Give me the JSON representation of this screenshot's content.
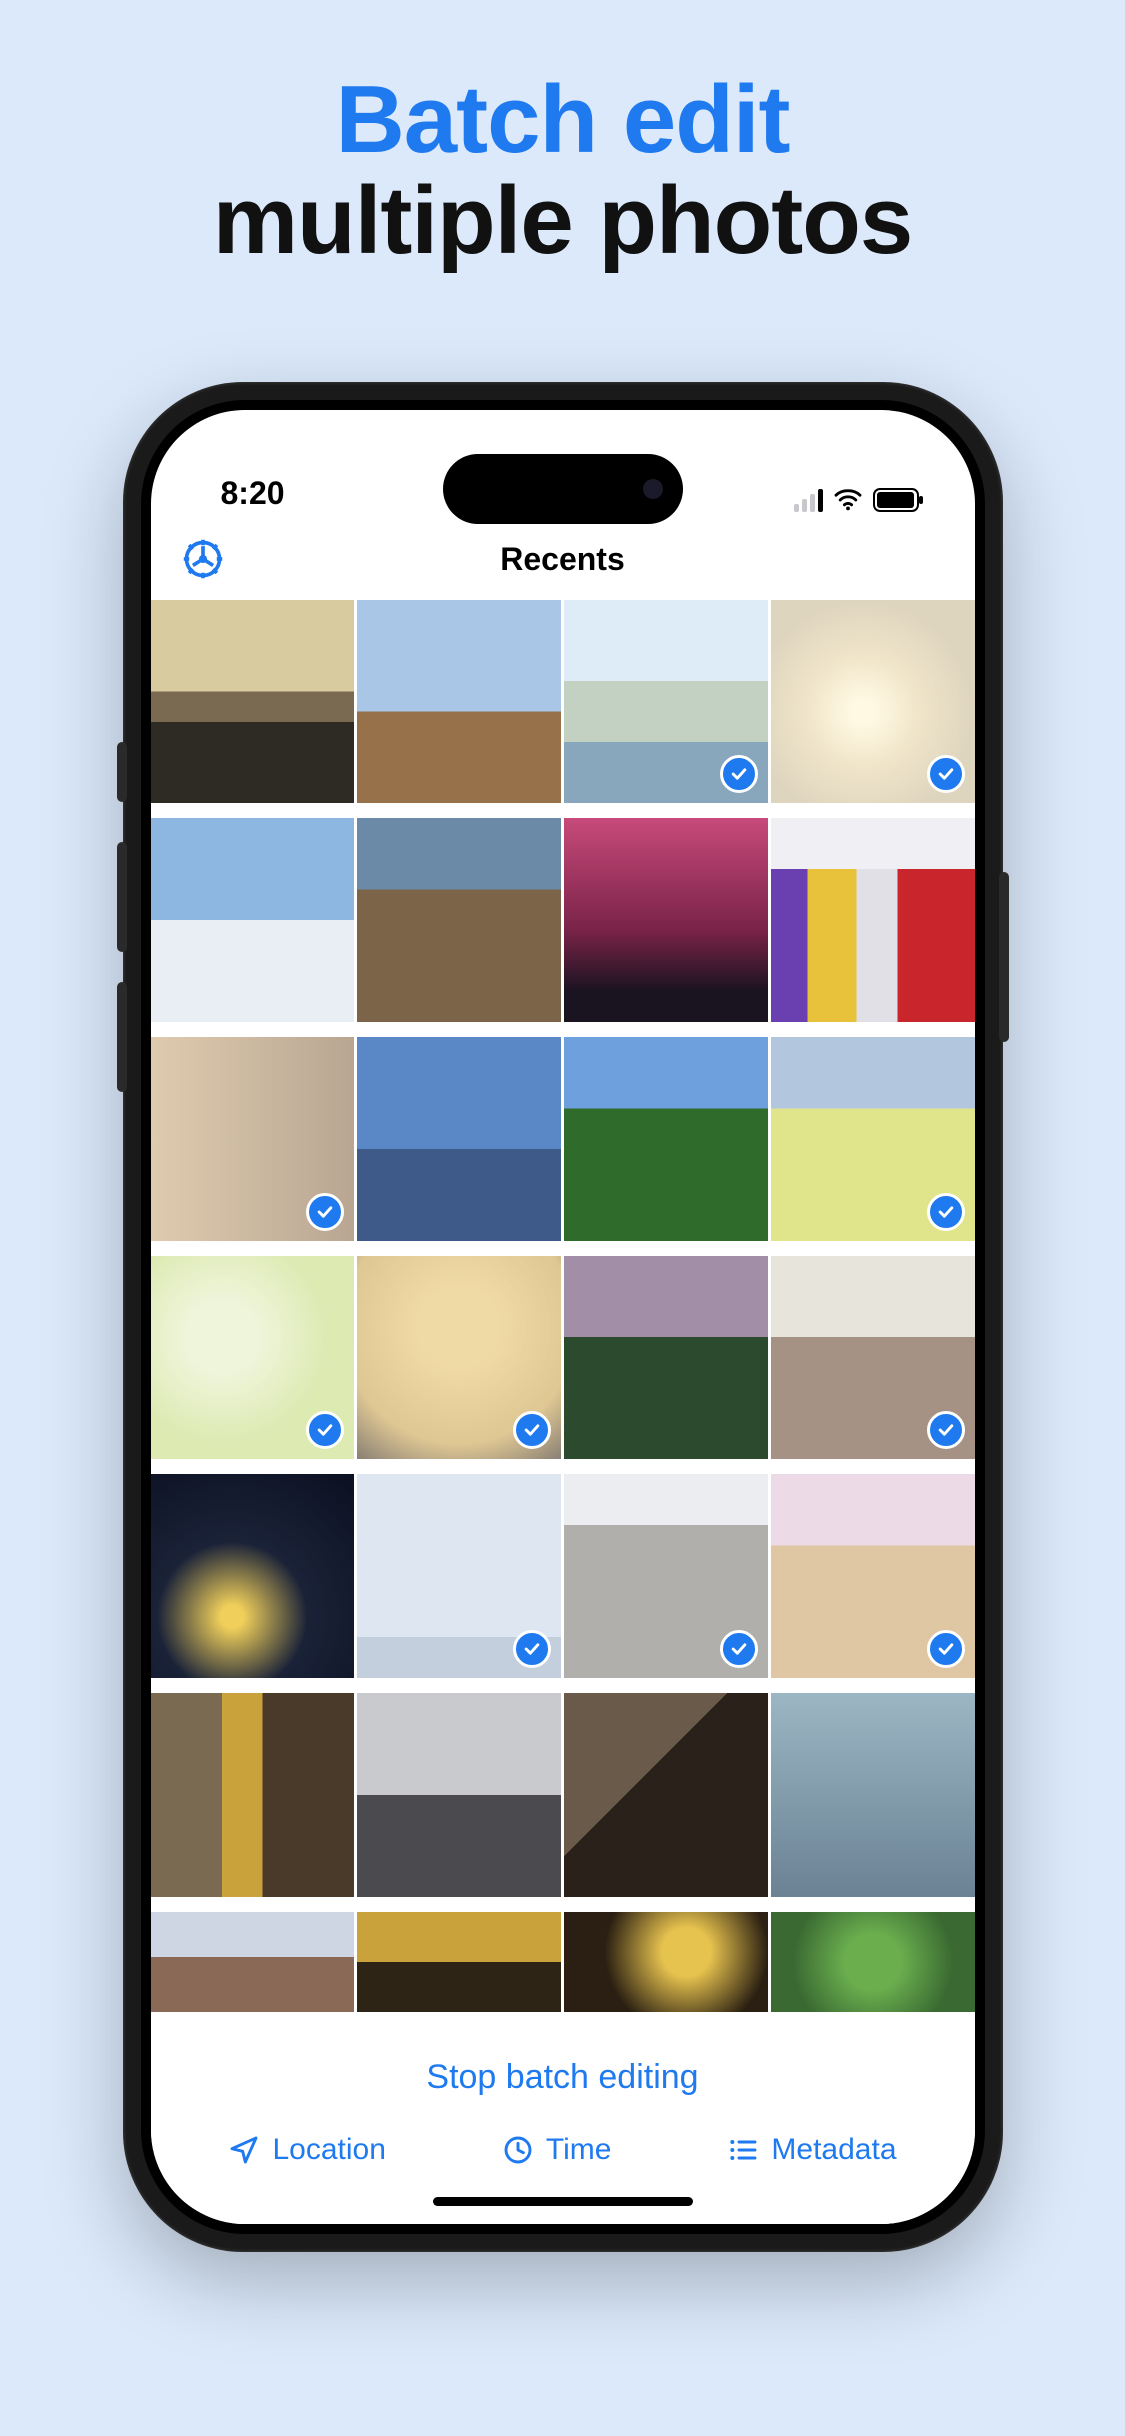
{
  "promo": {
    "line1": "Batch edit",
    "line2": "multiple photos"
  },
  "status": {
    "time": "8:20"
  },
  "header": {
    "title": "Recents"
  },
  "grid": {
    "columns": 4,
    "photos": [
      {
        "id": "t0",
        "selected": false
      },
      {
        "id": "t1",
        "selected": false
      },
      {
        "id": "t2",
        "selected": true
      },
      {
        "id": "t3",
        "selected": true
      },
      {
        "id": "t4",
        "selected": false
      },
      {
        "id": "t5",
        "selected": false
      },
      {
        "id": "t6",
        "selected": false
      },
      {
        "id": "t7",
        "selected": false
      },
      {
        "id": "t8",
        "selected": true
      },
      {
        "id": "t9",
        "selected": false
      },
      {
        "id": "t10",
        "selected": false
      },
      {
        "id": "t11",
        "selected": true
      },
      {
        "id": "t12",
        "selected": true
      },
      {
        "id": "t13",
        "selected": true
      },
      {
        "id": "t14",
        "selected": false
      },
      {
        "id": "t15",
        "selected": true
      },
      {
        "id": "t16",
        "selected": false
      },
      {
        "id": "t17",
        "selected": true
      },
      {
        "id": "t18",
        "selected": true
      },
      {
        "id": "t19",
        "selected": true
      },
      {
        "id": "t20",
        "selected": false
      },
      {
        "id": "t21",
        "selected": false
      },
      {
        "id": "t22",
        "selected": false
      },
      {
        "id": "t23",
        "selected": false
      },
      {
        "id": "t24",
        "selected": false,
        "partial": true
      },
      {
        "id": "t25",
        "selected": false,
        "partial": true
      },
      {
        "id": "t26",
        "selected": false,
        "partial": true
      },
      {
        "id": "t27",
        "selected": false,
        "partial": true
      }
    ]
  },
  "actions": {
    "stop": "Stop batch editing"
  },
  "toolbar": {
    "location": "Location",
    "time": "Time",
    "metadata": "Metadata"
  },
  "colors": {
    "accent": "#1f7af0",
    "background": "#dbe9fb"
  }
}
